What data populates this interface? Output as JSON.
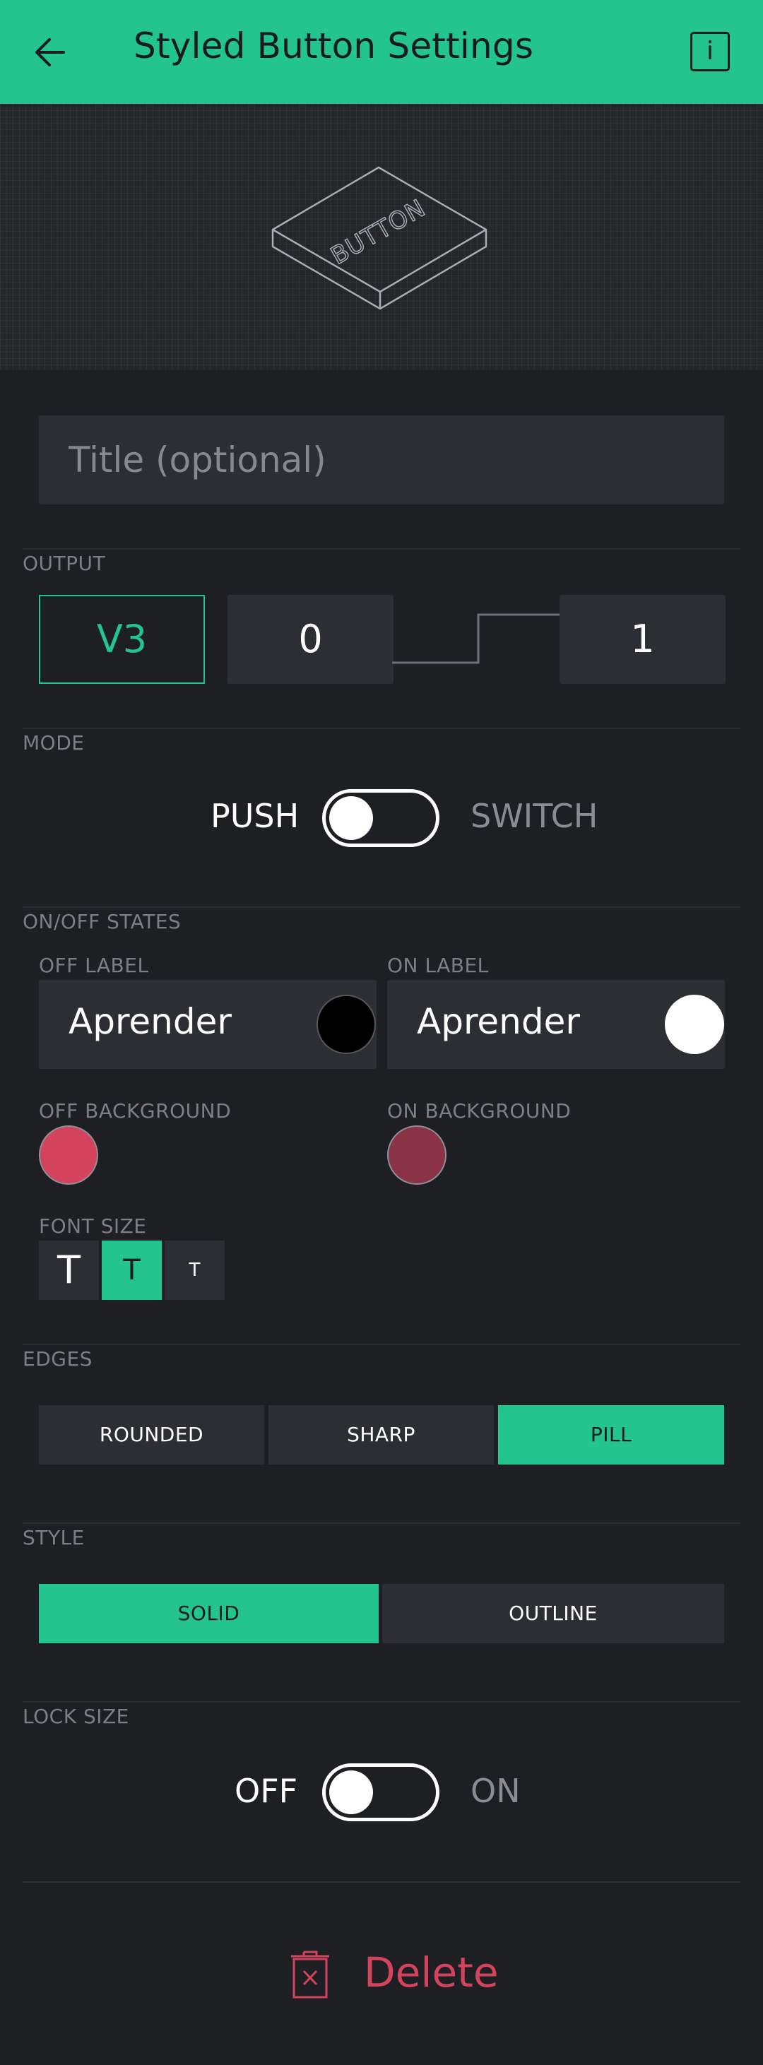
{
  "header": {
    "title": "Styled Button Settings",
    "back_icon": "arrow-left-icon",
    "info_icon": "info-icon",
    "info_glyph": "i"
  },
  "preview": {
    "art_label": "BUTTON"
  },
  "title_field": {
    "placeholder": "Title (optional)",
    "value": ""
  },
  "output": {
    "section_label": "OUTPUT",
    "pin": "V3",
    "off_value": "0",
    "on_value": "1"
  },
  "mode": {
    "section_label": "MODE",
    "left_label": "PUSH",
    "right_label": "SWITCH",
    "selected": "PUSH"
  },
  "states": {
    "section_label": "ON/OFF STATES",
    "off_label_caption": "OFF LABEL",
    "on_label_caption": "ON LABEL",
    "off_label_value": "Aprender",
    "on_label_value": "Aprender",
    "off_text_color": "#000000",
    "on_text_color": "#ffffff",
    "off_bg_caption": "OFF BACKGROUND",
    "on_bg_caption": "ON BACKGROUND",
    "off_bg_color": "#d3435c",
    "on_bg_color": "#8a3346"
  },
  "font_size": {
    "caption": "FONT SIZE",
    "options": [
      "T",
      "T",
      "T"
    ],
    "selected_index": 1
  },
  "edges": {
    "section_label": "EDGES",
    "options": [
      "ROUNDED",
      "SHARP",
      "PILL"
    ],
    "selected": "PILL"
  },
  "style": {
    "section_label": "STYLE",
    "options": [
      "SOLID",
      "OUTLINE"
    ],
    "selected": "SOLID"
  },
  "lock_size": {
    "section_label": "LOCK SIZE",
    "left_label": "OFF",
    "right_label": "ON",
    "selected": "OFF"
  },
  "delete": {
    "label": "Delete",
    "icon": "trash-icon"
  },
  "colors": {
    "accent": "#23c48e",
    "background": "#1e1f23",
    "danger": "#d3435c"
  }
}
